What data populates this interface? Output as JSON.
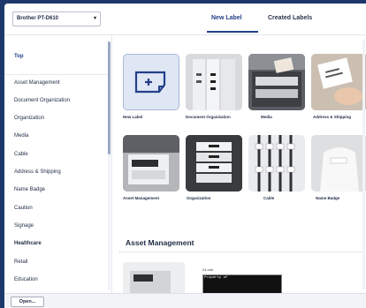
{
  "topbar": {
    "printer_select": "Brother PT-D610",
    "tabs": [
      {
        "label": "New Label",
        "active": true
      },
      {
        "label": "Created Labels",
        "active": false
      }
    ]
  },
  "sidebar": {
    "items": [
      {
        "label": "Top",
        "active": true
      },
      {
        "label": "Asset Management"
      },
      {
        "label": "Document Organization"
      },
      {
        "label": "Organization"
      },
      {
        "label": "Media"
      },
      {
        "label": "Cable"
      },
      {
        "label": "Address & Shipping"
      },
      {
        "label": "Name Badge"
      },
      {
        "label": "Caution"
      },
      {
        "label": "Signage"
      },
      {
        "label": "Healthcare",
        "bold": true
      },
      {
        "label": "Retail"
      },
      {
        "label": "Education"
      }
    ]
  },
  "main": {
    "tiles_row1": [
      {
        "label": "New Label"
      },
      {
        "label": "Document Organization"
      },
      {
        "label": "Media"
      },
      {
        "label": "Address & Shipping"
      }
    ],
    "tiles_row2": [
      {
        "label": "Asset Management"
      },
      {
        "label": "Organization"
      },
      {
        "label": "Cable"
      },
      {
        "label": "Name Badge"
      }
    ],
    "section_title": "Asset Management",
    "preview_caption": "24 mm",
    "preview_text": "Property of"
  },
  "bottombar": {
    "open_label": "Open..."
  },
  "colors": {
    "frame": "#1c386a",
    "accent": "#24408a",
    "new_label_tile": "#dfe6f4"
  }
}
